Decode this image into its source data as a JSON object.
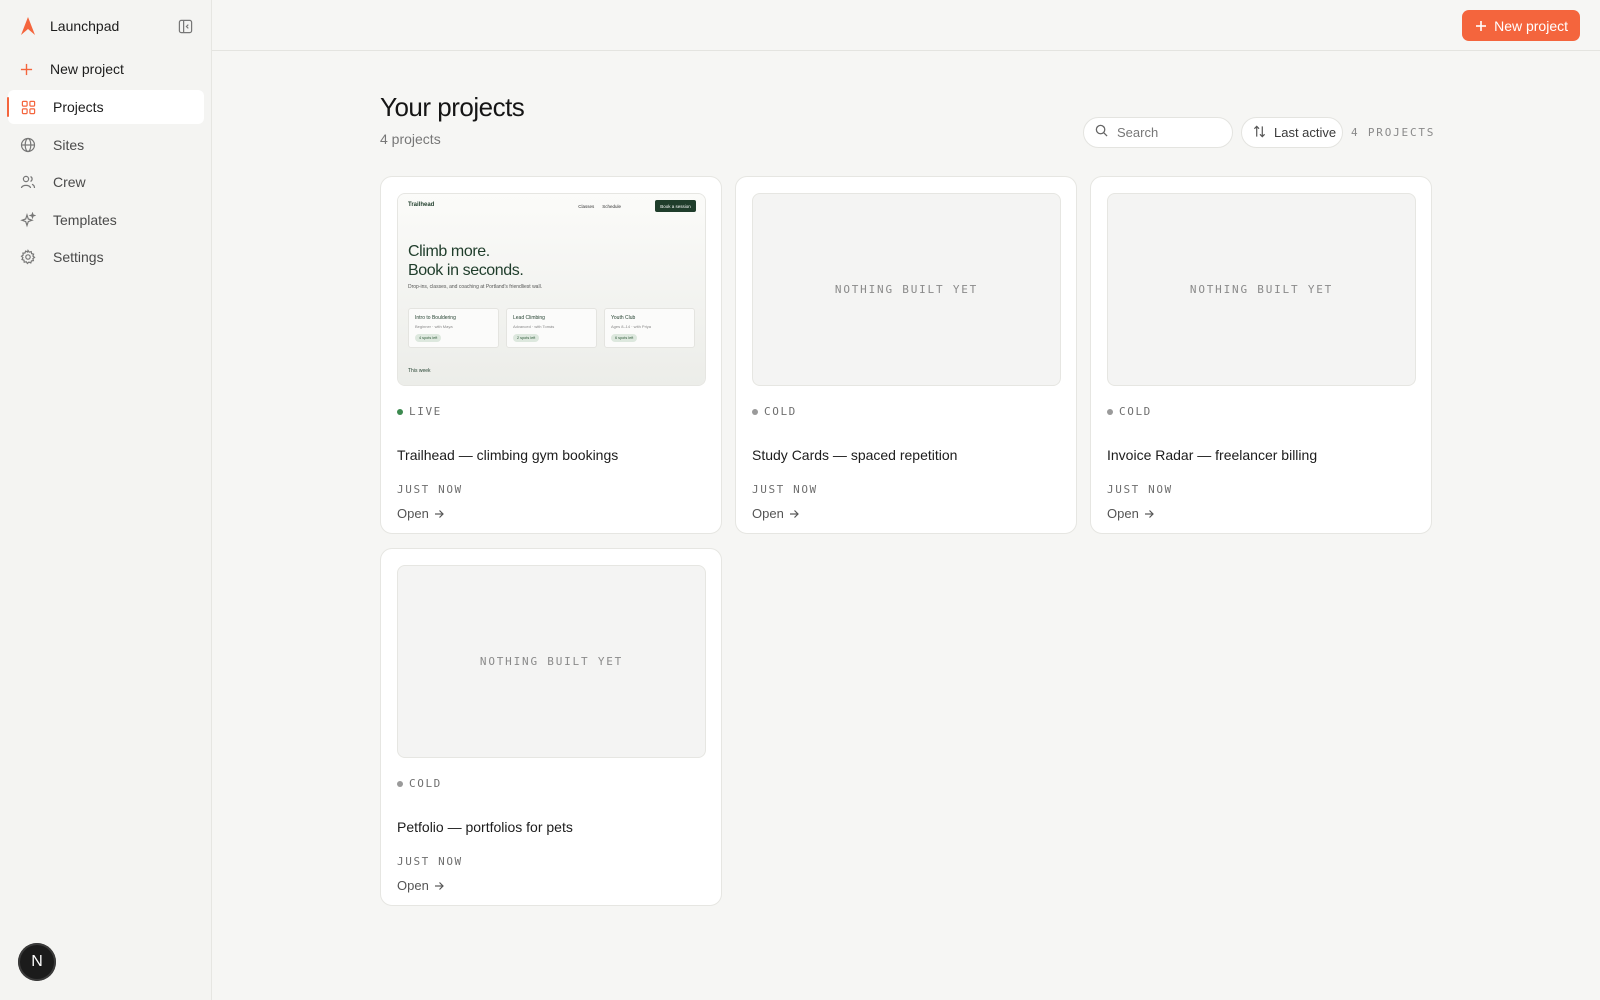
{
  "app": {
    "name": "Launchpad"
  },
  "sidebar": {
    "new_project_label": "New project",
    "items": [
      {
        "label": "Projects",
        "icon": "grid-icon",
        "active": true
      },
      {
        "label": "Sites",
        "icon": "globe-icon",
        "active": false
      },
      {
        "label": "Crew",
        "icon": "users-icon",
        "active": false
      },
      {
        "label": "Templates",
        "icon": "sparkle-icon",
        "active": false
      },
      {
        "label": "Settings",
        "icon": "gear-icon",
        "active": false
      }
    ],
    "avatar_initial": "N"
  },
  "topbar": {
    "new_project_label": "New project"
  },
  "main": {
    "title": "Your projects",
    "subtitle": "4 projects",
    "search_placeholder": "Search",
    "sort_label": "Last active",
    "count_label": "4 PROJECTS"
  },
  "projects": [
    {
      "title": "Trailhead — climbing gym bookings",
      "status": "LIVE",
      "time": "JUST NOW",
      "open_label": "Open",
      "preview": true
    },
    {
      "title": "Study Cards — spaced repetition",
      "status": "COLD",
      "time": "JUST NOW",
      "open_label": "Open",
      "empty_label": "NOTHING BUILT YET"
    },
    {
      "title": "Invoice Radar — freelancer billing",
      "status": "COLD",
      "time": "JUST NOW",
      "open_label": "Open",
      "empty_label": "NOTHING BUILT YET"
    },
    {
      "title": "Petfolio — portfolios for pets",
      "status": "COLD",
      "time": "JUST NOW",
      "open_label": "Open",
      "empty_label": "NOTHING BUILT YET"
    }
  ],
  "preview": {
    "brand": "Trailhead",
    "nav": [
      "Classes",
      "Schedule"
    ],
    "cta": "Book a session",
    "hero_line1": "Climb more.",
    "hero_line2": "Book in seconds.",
    "subtext": "Drop-ins, classes, and coaching at Portland's friendliest wall.",
    "cards": [
      {
        "title": "Intro to Bouldering",
        "sub": "Beginner · with Maya",
        "badge": "4 spots left"
      },
      {
        "title": "Lead Climbing",
        "sub": "Advanced · with Tomás",
        "badge": "2 spots left"
      },
      {
        "title": "Youth Club",
        "sub": "Ages 8–14 · with Priya",
        "badge": "6 spots left"
      }
    ],
    "week_label": "This week"
  },
  "colors": {
    "accent": "#f4653d",
    "live_dot": "#3c8a4f",
    "cold_dot": "#9a9a9a",
    "preview_green": "#1f3d2b"
  }
}
